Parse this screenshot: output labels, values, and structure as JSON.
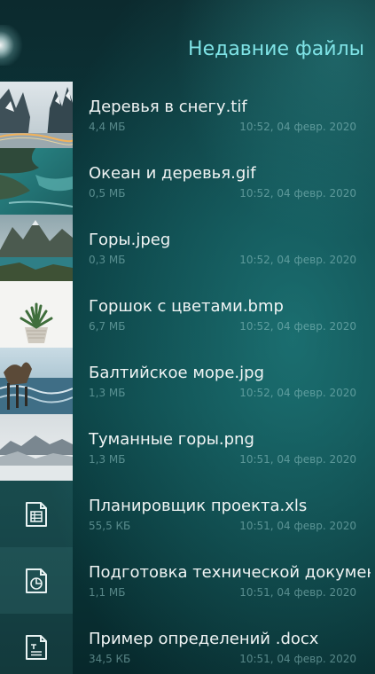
{
  "header": {
    "title": "Недавние файлы"
  },
  "colors": {
    "accent": "#7fe3e6",
    "primary_text": "#f0f4f4",
    "secondary_text": "#96c8c8",
    "background": "#0b3f42"
  },
  "files": [
    {
      "name": "Деревья в снегу.tif",
      "size": "4,4 МБ",
      "date": "10:52, 04 февр. 2020",
      "thumb": "snowy-trees-road-photo"
    },
    {
      "name": "Океан и деревья.gif",
      "size": "0,5 МБ",
      "date": "10:52, 04 февр. 2020",
      "thumb": "ocean-trees-photo"
    },
    {
      "name": "Горы.jpeg",
      "size": "0,3 МБ",
      "date": "10:52, 04 февр. 2020",
      "thumb": "mountain-lake-photo"
    },
    {
      "name": "Горшок с цветами.bmp",
      "size": "6,7 МБ",
      "date": "10:52, 04 февр. 2020",
      "thumb": "potted-plant-photo"
    },
    {
      "name": "Балтийское море.jpg",
      "size": "1,3 МБ",
      "date": "10:52, 04 февр. 2020",
      "thumb": "baltic-sea-photo"
    },
    {
      "name": "Туманные горы.png",
      "size": "1,3 МБ",
      "date": "10:51, 04 февр. 2020",
      "thumb": "foggy-mountains-photo"
    },
    {
      "name": "Планировщик проекта.xls",
      "size": "55,5 КБ",
      "date": "10:51, 04 февр. 2020",
      "thumb": "spreadsheet-icon"
    },
    {
      "name": "Подготовка технической документации",
      "size": "1,1 МБ",
      "date": "10:51, 04 февр. 2020",
      "thumb": "presentation-icon"
    },
    {
      "name": "Пример определений .docx",
      "size": "34,5 КБ",
      "date": "10:51, 04 февр. 2020",
      "thumb": "text-document-icon"
    }
  ]
}
